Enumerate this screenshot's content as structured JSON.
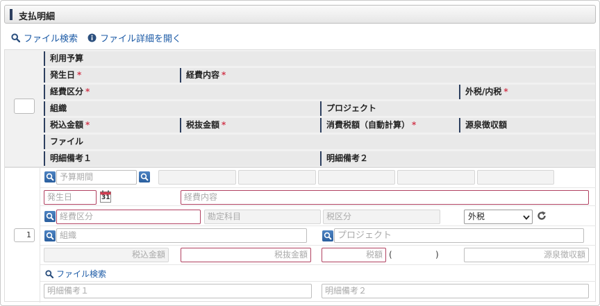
{
  "section": {
    "title": "支払明細"
  },
  "toolbar": {
    "file_search": "ファイル検索",
    "file_details": "ファイル詳細を開く"
  },
  "header": {
    "budget": "利用予算",
    "date": "発生日",
    "expense_content": "経費内容",
    "expense_category": "経費区分",
    "tax_type": "外税/内税",
    "organization": "組織",
    "project": "プロジェクト",
    "amount_incl_tax": "税込金額",
    "amount_excl_tax": "税抜金額",
    "consumption_tax_auto": "消費税額（自動計算）",
    "withholding": "源泉徴収額",
    "file": "ファイル",
    "remark1": "明細備考１",
    "remark2": "明細備考２",
    "required_mark": "*"
  },
  "row": {
    "number": "1",
    "budget_period_placeholder": "予算期間",
    "date_placeholder": "発生日",
    "calendar_day": "31",
    "expense_content_placeholder": "経費内容",
    "expense_category_placeholder": "経費区分",
    "account_item_placeholder": "勘定科目",
    "tax_category_placeholder": "税区分",
    "tax_select_value": "外税",
    "organization_placeholder": "組織",
    "project_placeholder": "プロジェクト",
    "amount_incl_placeholder": "税込金額",
    "amount_excl_placeholder": "税抜金額",
    "tax_amount_placeholder": "税額",
    "paren_open": "(",
    "paren_close": ")",
    "withholding_placeholder": "源泉徴収額",
    "file_search": "ファイル検索",
    "remark1_placeholder": "明細備考１",
    "remark2_placeholder": "明細備考２"
  },
  "colors": {
    "accent": "#2d3f5f",
    "link": "#1b5aa6",
    "required": "#d23c50",
    "required_border": "#b04060"
  }
}
